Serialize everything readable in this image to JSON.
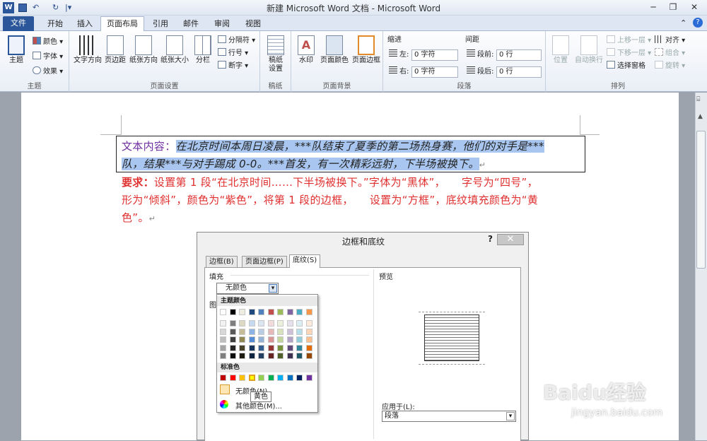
{
  "window": {
    "title": "新建 Microsoft Word 文档 - Microsoft Word",
    "undo": "↶",
    "redo": "↻",
    "customize": "|▾"
  },
  "winbtns": {
    "minimize": "─",
    "restore": "❐",
    "close": "✕"
  },
  "tabs": {
    "file": "文件",
    "home": "开始",
    "insert": "插入",
    "layout": "页面布局",
    "references": "引用",
    "mailings": "邮件",
    "review": "审阅",
    "view": "视图"
  },
  "ribbon": {
    "themes": {
      "theme": "主题",
      "colors": "颜色",
      "fonts": "字体",
      "effects": "效果",
      "group": "主题"
    },
    "pagesetup": {
      "direction": "文字方向",
      "margins": "页边距",
      "orientation": "纸张方向",
      "size": "纸张大小",
      "columns": "分栏",
      "breaks": "分隔符",
      "linenumbers": "行号",
      "hyphen": "断字",
      "group": "页面设置"
    },
    "draft": {
      "label1": "稿纸",
      "label2": "设置",
      "group": "稿纸"
    },
    "background": {
      "watermark": "水印",
      "pagecolor": "页面颜色",
      "borders": "页面边框",
      "group": "页面背景"
    },
    "paragraph": {
      "indent": "缩进",
      "left": "左:",
      "right": "右:",
      "left_val": "0 字符",
      "right_val": "0 字符",
      "spacing": "间距",
      "before": "段前:",
      "after": "段后:",
      "before_val": "0 行",
      "after_val": "0 行",
      "group": "段落"
    },
    "arrange": {
      "position": "位置",
      "wrap": "自动换行",
      "forward": "上移一层",
      "backward": "下移一层",
      "pane": "选择窗格",
      "align": "对齐",
      "group_btn": "组合",
      "rotate": "旋转",
      "group": "排列"
    }
  },
  "doc": {
    "line1_label": "文本内容：",
    "line1_text": "在北京时间本周日凌晨，***队结束了夏季的第二场热身赛，他们的对手是***",
    "line2_text": "队，结果***与对手踢成 0-0。***首发，有一次精彩远射，下半场被换下。",
    "req1_label": "要求：",
    "req1": "设置第 1 段“在北京时间……下半场被换下。”字体为“黑体”，　　字号为“四号”，",
    "req2": "形为“倾斜”，颜色为“紫色”，将第 1 段的边框，　　设置为“方框”，底纹填充颜色为“黄",
    "req3": "色”。",
    "mark": "↵"
  },
  "dialog": {
    "title": "边框和底纹",
    "help": "?",
    "tabs": [
      "边框(B)",
      "页面边框(P)",
      "底纹(S)"
    ],
    "fill_label": "填充",
    "fill_value": "无颜色",
    "pattern_label": "图",
    "preview_label": "预览",
    "apply_label": "应用于(L):",
    "apply_value": "段落"
  },
  "palette": {
    "theme_label": "主题颜色",
    "standard_label": "标准色",
    "no_color": "无颜色(N)",
    "more": "其他颜色(M)...",
    "tooltip": "黄色",
    "theme_top": [
      "#ffffff",
      "#000000",
      "#eeece1",
      "#1f497d",
      "#4f81bd",
      "#c0504d",
      "#9bbb59",
      "#8064a2",
      "#4bacc6",
      "#f79646"
    ],
    "theme_shades": [
      [
        "#f2f2f2",
        "#7f7f7f",
        "#ddd9c3",
        "#c6d9f0",
        "#dbe5f1",
        "#f2dcdb",
        "#ebf1dd",
        "#e5e0ec",
        "#dbeef3",
        "#fdeada"
      ],
      [
        "#d8d8d8",
        "#595959",
        "#c4bd97",
        "#8db3e2",
        "#b8cce4",
        "#e5b9b7",
        "#d7e3bc",
        "#ccc1d9",
        "#b7dde8",
        "#fbd5b5"
      ],
      [
        "#bfbfbf",
        "#3f3f3f",
        "#938953",
        "#548dd4",
        "#95b3d7",
        "#d99694",
        "#c3d69b",
        "#b2a2c7",
        "#92cddc",
        "#fac08f"
      ],
      [
        "#a5a5a5",
        "#262626",
        "#494429",
        "#17365d",
        "#366092",
        "#953734",
        "#76923c",
        "#5f497a",
        "#31859b",
        "#e36c09"
      ],
      [
        "#7f7f7f",
        "#0c0c0c",
        "#1d1b10",
        "#0f243e",
        "#244061",
        "#632423",
        "#4f6128",
        "#3f3151",
        "#205867",
        "#974806"
      ]
    ],
    "standard": [
      "#c00000",
      "#ff0000",
      "#ffc000",
      "#ffff00",
      "#92d050",
      "#00b050",
      "#00b0f0",
      "#0070c0",
      "#002060",
      "#7030a0"
    ]
  },
  "watermark": "Baidu经验",
  "watermark_url": "jingyan.baidu.com"
}
